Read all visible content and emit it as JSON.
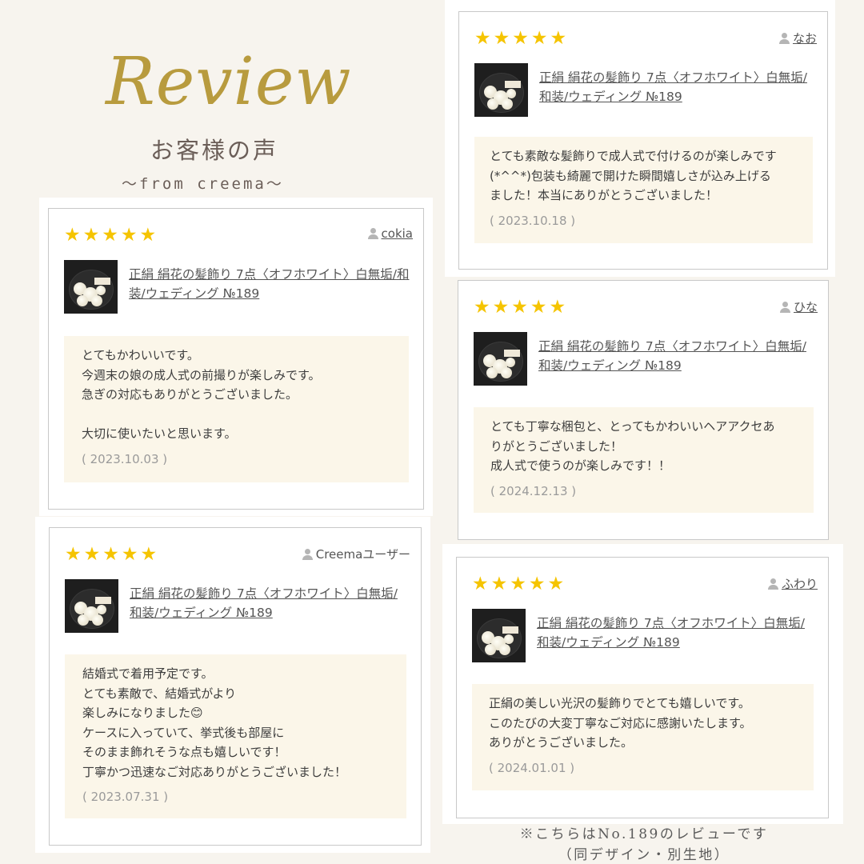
{
  "header": {
    "title": "Review",
    "subtitle": "お客様の声",
    "source": "〜from creema〜"
  },
  "colors": {
    "accent": "#b89b3e",
    "star": "#f5c400",
    "body_bg": "#fbf6e9",
    "page_bg": "#f7f4ee"
  },
  "icons": {
    "star": "star-icon",
    "user": "user-icon"
  },
  "reviews": [
    {
      "stars": "★★★★★",
      "rating": 5,
      "user": "cokia",
      "product": "正絹 絹花の髪飾り 7点〈オフホワイト〉白無垢/和装/ウェディング №189",
      "body": "とてもかわいいです。\n今週末の娘の成人式の前撮りが楽しみです。\n急ぎの対応もありがとうございました。\n\n大切に使いたいと思います。",
      "date": "( 2023.10.03 )"
    },
    {
      "stars": "★★★★★",
      "rating": 5,
      "user": "Creemaユーザー",
      "product": "正絹 絹花の髪飾り 7点〈オフホワイト〉白無垢/和装/ウェディング №189",
      "body": "結婚式で着用予定です。\nとても素敵で、結婚式がより\n楽しみになりました😊\nケースに入っていて、挙式後も部屋に\nそのまま飾れそうな点も嬉しいです！\n丁寧かつ迅速なご対応ありがとうございました！",
      "date": "( 2023.07.31 )"
    },
    {
      "stars": "★★★★★",
      "rating": 5,
      "user": "なお",
      "product": "正絹 絹花の髪飾り 7点〈オフホワイト〉白無垢/和装/ウェディング №189",
      "body": "とても素敵な髪飾りで成人式で付けるのが楽しみです\n(*^^*)包装も綺麗で開けた瞬間嬉しさが込み上げる\nました！本当にありがとうございました！",
      "date": "( 2023.10.18 )"
    },
    {
      "stars": "★★★★★",
      "rating": 5,
      "user": "ひな",
      "product": "正絹 絹花の髪飾り 7点〈オフホワイト〉白無垢/和装/ウェディング №189",
      "body": "とても丁寧な梱包と、とってもかわいいヘアアクセあ\nりがとうございました！\n成人式で使うのが楽しみです！！",
      "date": "( 2024.12.13 )"
    },
    {
      "stars": "★★★★★",
      "rating": 5,
      "user": "ふわり",
      "product": "正絹 絹花の髪飾り 7点〈オフホワイト〉白無垢/和装/ウェディング №189",
      "body": "正絹の美しい光沢の髪飾りでとても嬉しいです。\nこのたびの大変丁寧なご対応に感謝いたします。\nありがとうございました。",
      "date": "( 2024.01.01 )"
    }
  ],
  "note": {
    "line1": "※こちらはNo.189のレビューです",
    "line2": "（同デザイン・別生地）"
  }
}
